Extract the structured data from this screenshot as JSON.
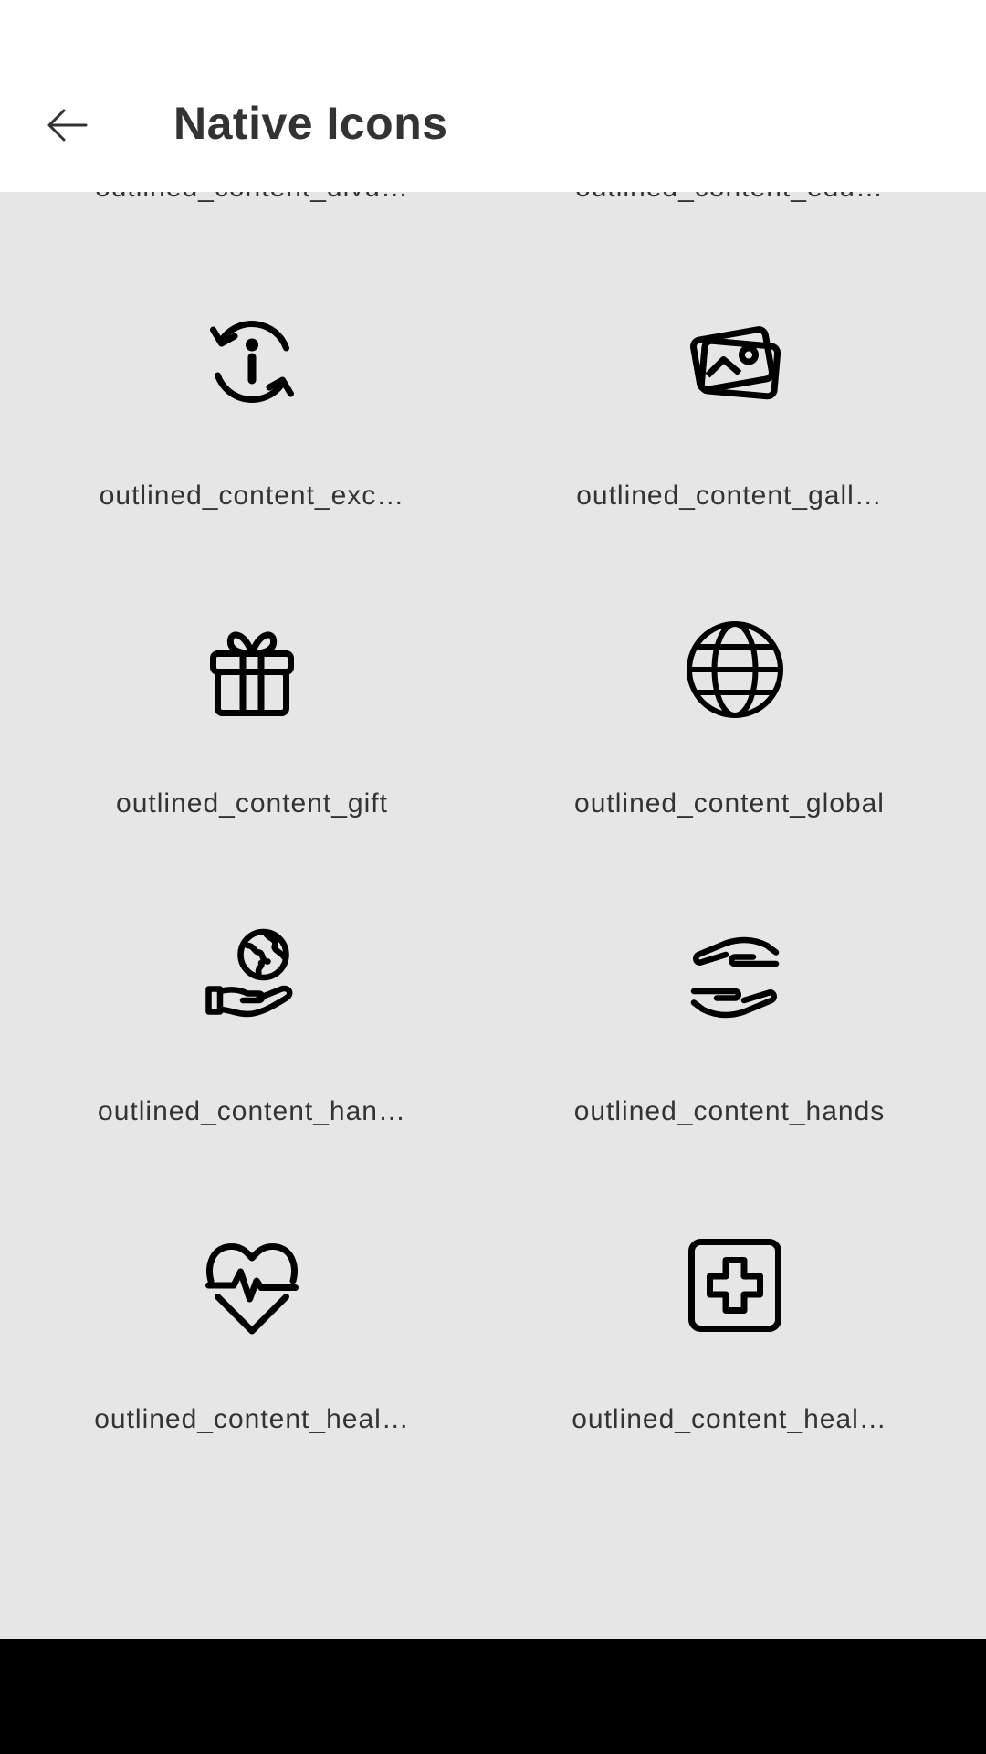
{
  "header": {
    "title": "Native Icons"
  },
  "icons": [
    {
      "label": "outlined_content_divu…",
      "icon": "newspaper-icon"
    },
    {
      "label": "outlined_content_edu…",
      "icon": "education-icon"
    },
    {
      "label": "outlined_content_exc…",
      "icon": "exchange-info-icon"
    },
    {
      "label": "outlined_content_gall…",
      "icon": "gallery-icon"
    },
    {
      "label": "outlined_content_gift",
      "icon": "gift-icon"
    },
    {
      "label": "outlined_content_global",
      "icon": "globe-icon"
    },
    {
      "label": "outlined_content_han…",
      "icon": "hand-globe-icon"
    },
    {
      "label": "outlined_content_hands",
      "icon": "hands-icon"
    },
    {
      "label": "outlined_content_heal…",
      "icon": "heartbeat-icon"
    },
    {
      "label": "outlined_content_heal…",
      "icon": "health-cross-icon"
    }
  ]
}
